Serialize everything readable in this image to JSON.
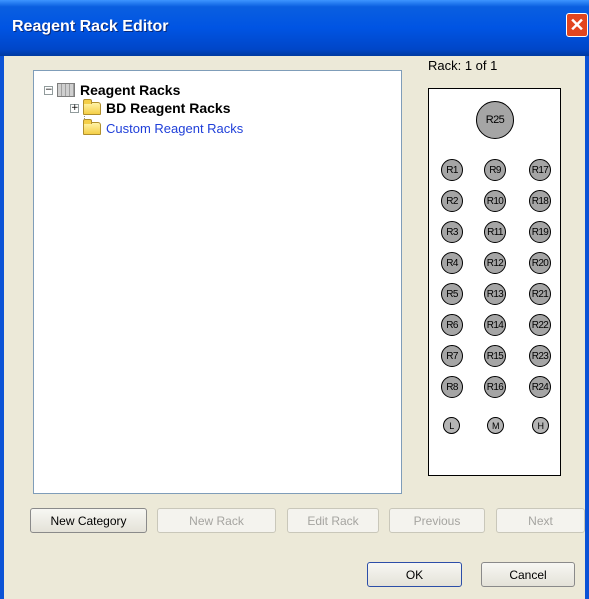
{
  "window": {
    "title": "Reagent Rack Editor",
    "close_glyph": "✕"
  },
  "tree": {
    "root": {
      "label": "Reagent Racks",
      "expander": "−",
      "icon": "rack-icon"
    },
    "children": [
      {
        "label": "BD Reagent Racks",
        "expander": "+",
        "icon": "folder-icon",
        "style": "bold"
      },
      {
        "label": "Custom Reagent Racks",
        "icon": "folder-icon",
        "color": "#1f3fd9"
      }
    ]
  },
  "rack": {
    "label": "Rack:  1 of 1",
    "top_position": "R25",
    "columns": [
      [
        "R1",
        "R2",
        "R3",
        "R4",
        "R5",
        "R6",
        "R7",
        "R8"
      ],
      [
        "R9",
        "R10",
        "R11",
        "R12",
        "R13",
        "R14",
        "R15",
        "R16"
      ],
      [
        "R17",
        "R18",
        "R19",
        "R20",
        "R21",
        "R22",
        "R23",
        "R24"
      ]
    ],
    "bottom_positions": [
      "L",
      "M",
      "H"
    ]
  },
  "buttons": {
    "new_category": "New Category",
    "new_rack": "New Rack",
    "edit_rack": "Edit Rack",
    "previous": "Previous",
    "next": "Next",
    "ok": "OK",
    "cancel": "Cancel"
  },
  "colors": {
    "titlebar": "#0054e3",
    "dialog_bg": "#ece9d8",
    "link_blue": "#1f3fd9",
    "close_red": "#e2451f"
  }
}
